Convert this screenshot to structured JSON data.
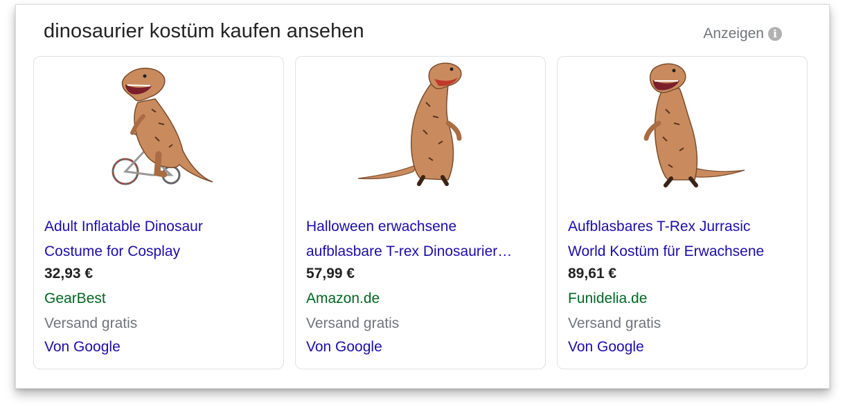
{
  "header": {
    "title": "dinosaurier kostüm kaufen ansehen",
    "ads_label": "Anzeigen",
    "info_icon": "i"
  },
  "products": [
    {
      "title_line1": "Adult Inflatable Dinosaur",
      "title_line2": "Costume for Cosplay",
      "price": "32,93 €",
      "merchant": "GearBest",
      "shipping": "Versand gratis",
      "source": "Von Google",
      "image": "t-rex-costume-on-bicycle"
    },
    {
      "title_line1": "Halloween erwachsene",
      "title_line2": "aufblasbare T-rex Dinosaurier…",
      "price": "57,99 €",
      "merchant": "Amazon.de",
      "shipping": "Versand gratis",
      "source": "Von Google",
      "image": "t-rex-costume-standing"
    },
    {
      "title_line1": "Aufblasbares T-Rex Jurrasic",
      "title_line2": "World Kostüm für Erwachsene",
      "price": "89,61 €",
      "merchant": "Funidelia.de",
      "shipping": "Versand gratis",
      "source": "Von Google",
      "image": "t-rex-costume-standing"
    }
  ],
  "colors": {
    "link": "#1a0dab",
    "merchant": "#006621",
    "muted": "#70757a",
    "costume": "#c98b5e"
  }
}
